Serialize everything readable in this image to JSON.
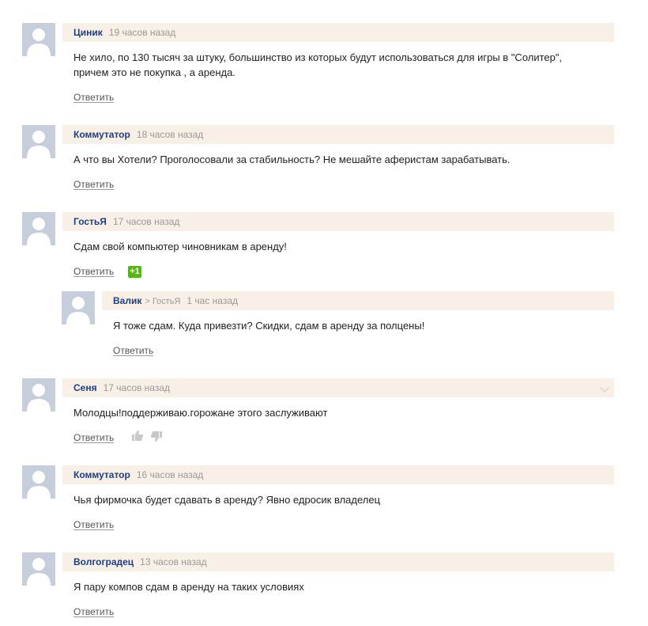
{
  "comments": [
    {
      "author": "Циник",
      "time": "19 часов назад",
      "text_lines": [
        "Не хило, по 130 тысяч за штуку, большинство из которых будут использоваться для игры в \"Солитер\",",
        "причем это не покупка , а аренда."
      ],
      "reply_label": "Ответить"
    },
    {
      "author": "Коммутатор",
      "time": "18 часов назад",
      "text_lines": [
        "А что вы Хотели? Проголосовали за стабильность? Не мешайте аферистам зарабатывать."
      ],
      "reply_label": "Ответить"
    },
    {
      "author": "ГостьЯ",
      "time": "17 часов назад",
      "text_lines": [
        "Сдам свой компьютер чиновникам в аренду!"
      ],
      "reply_label": "Ответить",
      "rating": "+1"
    },
    {
      "author": "Валик",
      "reply_to": "> ГостьЯ",
      "time": "1 час назад",
      "text_lines": [
        "Я тоже сдам. Куда привезти? Скидки, сдам в аренду за полцены!"
      ],
      "reply_label": "Ответить"
    },
    {
      "author": "Сеня",
      "time": "17 часов назад",
      "text_lines": [
        "Молодцы!поддерживаю.горожане этого заслуживают"
      ],
      "reply_label": "Ответить",
      "vote_icons": [
        "thumbs-up-icon",
        "thumbs-down-icon"
      ],
      "menu_icon": "chevron-down-icon"
    },
    {
      "author": "Коммутатор",
      "time": "16 часов назад",
      "text_lines": [
        "Чья фирмочка будет сдавать в аренду? Явно едросик владелец"
      ],
      "reply_label": "Ответить"
    },
    {
      "author": "Волгоградец",
      "time": "13 часов назад",
      "text_lines": [
        "Я пару компов сдам в аренду на таких условиях"
      ],
      "reply_label": "Ответить"
    }
  ],
  "colors": {
    "author": "#1d3f86",
    "header_bg": "#f8efe6",
    "avatar_bg": "#c7cedb",
    "rating_badge": "#59b31c"
  }
}
